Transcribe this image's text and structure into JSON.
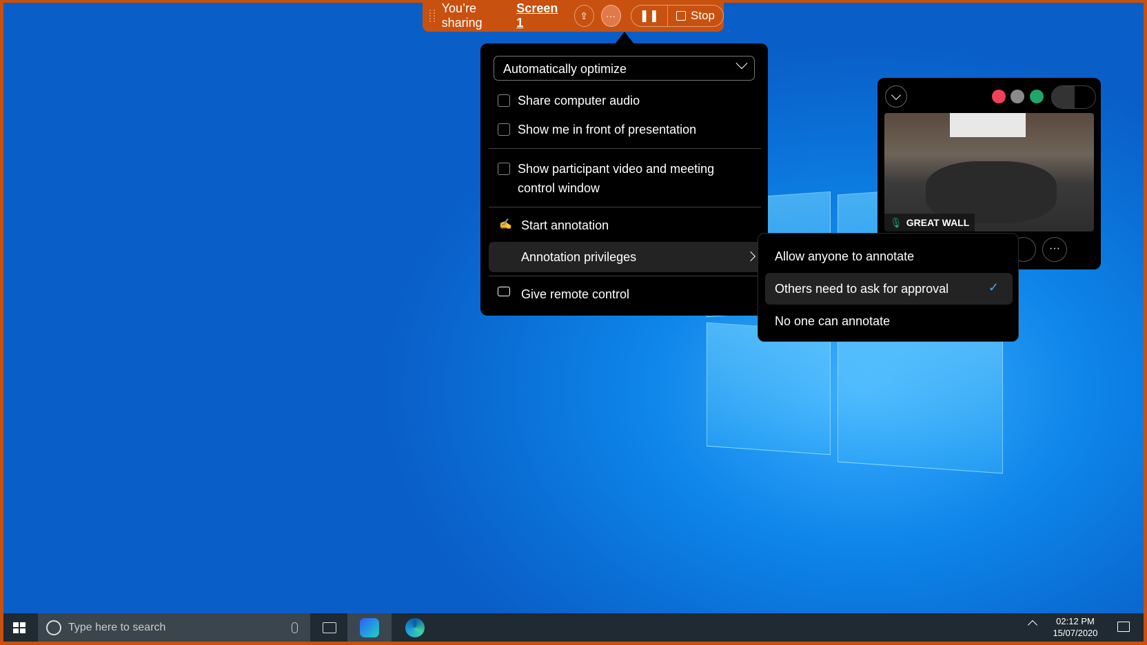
{
  "share_bar": {
    "prefix": "You’re sharing",
    "target": "Screen 1",
    "stop_label": "Stop",
    "icons": [
      "upload-icon",
      "more-icon",
      "pause-icon",
      "stop-icon"
    ]
  },
  "share_menu": {
    "optimize_dropdown": "Automatically optimize",
    "options": [
      {
        "label": "Share computer audio",
        "checked": false
      },
      {
        "label": "Show me in front of presentation",
        "checked": false
      },
      {
        "label": "Show participant video and meeting",
        "label2": "control window",
        "checked": false
      }
    ],
    "start_annotation": "Start annotation",
    "annotation_privileges": "Annotation privileges",
    "give_remote_control": "Give remote control"
  },
  "privileges_submenu": {
    "items": [
      {
        "label": "Allow anyone to annotate",
        "selected": false
      },
      {
        "label": "Others need to ask for approval",
        "selected": true
      },
      {
        "label": "No one can annotate",
        "selected": false
      }
    ]
  },
  "video_panel": {
    "participant": "GREAT WALL",
    "status_colors": {
      "record": "#f0405a",
      "link": "#8a8a8a",
      "signal": "#1fa66a"
    }
  },
  "taskbar": {
    "search_placeholder": "Type here to search",
    "time": "02:12 PM",
    "date": "15/07/2020"
  },
  "colors": {
    "accent": "#c8510f",
    "check": "#4aa3ff"
  }
}
